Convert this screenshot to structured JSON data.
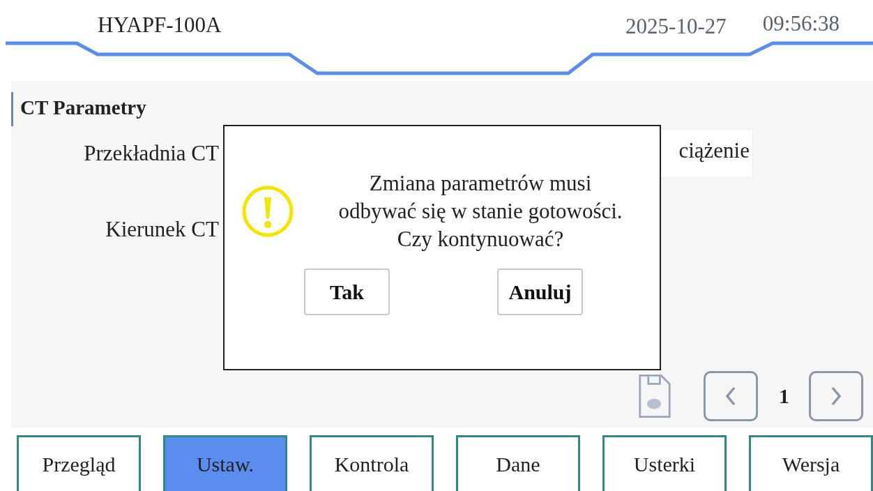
{
  "header": {
    "title": "HYAPF-100A",
    "date": "2025-10-27",
    "time": "09:56:38"
  },
  "section": {
    "title": "CT Parametry"
  },
  "fields": [
    {
      "label": "Przekładnia CT"
    },
    {
      "label": "Kierunek CT"
    }
  ],
  "partial_button": "ciążenie",
  "pager": {
    "page": "1"
  },
  "dialog": {
    "message": "Zmiana parametrów musi odbywać się w stanie gotowości. Czy kontynuować?",
    "buttons": [
      "Tak",
      "Anuluj"
    ]
  },
  "tabs": [
    {
      "label": "Przegląd",
      "selected": false
    },
    {
      "label": "Ustaw.",
      "selected": true
    },
    {
      "label": "Kontrola",
      "selected": false
    },
    {
      "label": "Dane",
      "selected": false
    },
    {
      "label": "Usterki",
      "selected": false
    },
    {
      "label": "Wersja",
      "selected": false
    }
  ]
}
